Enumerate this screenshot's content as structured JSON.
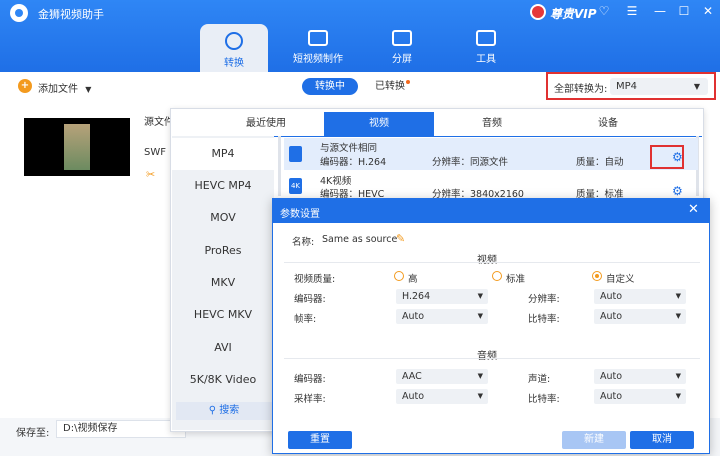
{
  "app": {
    "title": "金狮视频助手",
    "vip_label": "尊贵VIP",
    "win_buttons": [
      "♡",
      "☰",
      "—",
      "☐",
      "✕"
    ]
  },
  "nav": {
    "tabs": [
      {
        "label": "转换"
      },
      {
        "label": "短视频制作"
      },
      {
        "label": "分屏"
      },
      {
        "label": "工具"
      }
    ]
  },
  "toolbar": {
    "add_file": "添加文件",
    "add_file_caret": "▼",
    "seg_converting": "转换中",
    "seg_converted": "已转换",
    "convert_all_label": "全部转换为:",
    "convert_all_value": "MP4"
  },
  "file": {
    "source_label": "源文件",
    "format_label": "SWF"
  },
  "bottom": {
    "save_label": "保存至:",
    "save_path": "D:\\视频保存"
  },
  "format_panel": {
    "tabs": [
      "最近使用",
      "视频",
      "音频",
      "设备"
    ],
    "sidebar": [
      "MP4",
      "HEVC MP4",
      "MOV",
      "ProRes",
      "MKV",
      "HEVC MKV",
      "AVI",
      "5K/8K Video"
    ],
    "search_label": "搜索",
    "presets": [
      {
        "icon_text": "",
        "name": "与源文件相同",
        "codec": "编码器：H.264",
        "resolution": "分辨率：同源文件",
        "quality": "质量：自动"
      },
      {
        "icon_text": "4K",
        "name": "4K视频",
        "codec": "编码器：HEVC",
        "resolution": "分辨率：3840x2160",
        "quality": "质量：标准"
      }
    ]
  },
  "dialog": {
    "title": "参数设置",
    "name_label": "名称:",
    "name_value": "Same as source",
    "video_section": "视频",
    "quality_label": "视频质量:",
    "quality_options": [
      "高",
      "标准",
      "自定义"
    ],
    "video_encoder_label": "编码器:",
    "video_encoder_value": "H.264",
    "resolution_label": "分辨率:",
    "resolution_value": "Auto",
    "framerate_label": "帧率:",
    "framerate_value": "Auto",
    "bitrate_label": "比特率:",
    "bitrate_value": "Auto",
    "audio_section": "音频",
    "audio_encoder_label": "编码器:",
    "audio_encoder_value": "AAC",
    "channel_label": "声道:",
    "channel_value": "Auto",
    "samplerate_label": "采样率:",
    "samplerate_value": "Auto",
    "audio_bitrate_label": "比特率:",
    "audio_bitrate_value": "Auto",
    "reset_button": "重置",
    "new_button": "新建",
    "cancel_button": "取消"
  }
}
